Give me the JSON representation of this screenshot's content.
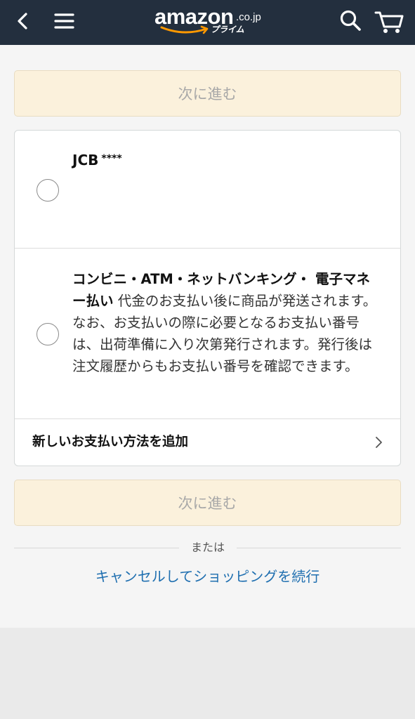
{
  "header": {
    "logo_word": "amazon",
    "logo_domain": ".co.jp",
    "logo_sub": "プライム",
    "icons": [
      "chevron-left-icon",
      "hamburger-menu-icon",
      "search-icon",
      "cart-icon"
    ]
  },
  "continue_button": {
    "label": "次に進む"
  },
  "payment_options": {
    "jcb": {
      "label": "JCB",
      "mask": "****"
    },
    "konbini": {
      "title": "コンビニ・ATM・ネットバンキング・ 電子マネー払い",
      "description": " 代金のお支払い後に商品が発送されます。なお、お支払いの際に必要となるお支払い番号は、出荷準備に入り次第発行されます。発行後は注文履歴からもお支払い番号を確認できます。"
    },
    "add_new": {
      "label": "新しいお支払い方法を追加"
    }
  },
  "or_text": "または",
  "cancel_link": "キャンセルしてショッピングを続行",
  "colors": {
    "header_bg": "#232f3e",
    "button_bg": "#fbf1dc",
    "link": "#1f6fb0",
    "smile": "#ff9900"
  }
}
